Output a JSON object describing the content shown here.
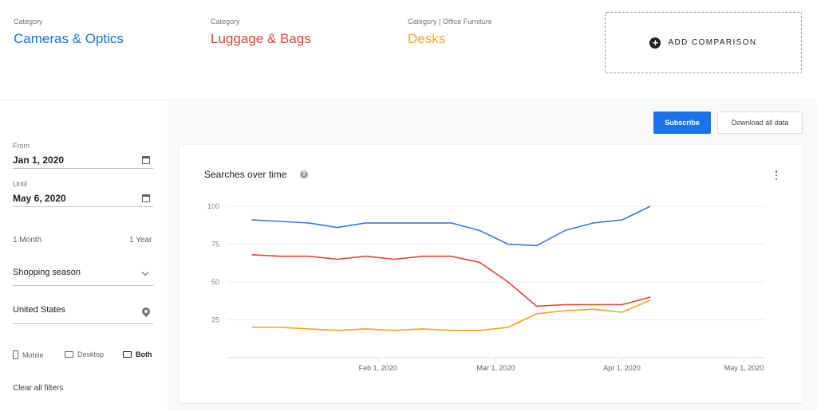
{
  "header": {
    "terms": [
      {
        "category": "Category",
        "name": "Cameras & Optics",
        "color": "#4285f4"
      },
      {
        "category": "Category",
        "name": "Luggage & Bags",
        "color": "#ea4335"
      },
      {
        "category": "Category | Office Furniture",
        "name": "Desks",
        "color": "#fbbc04"
      }
    ],
    "add_comparison": "ADD COMPARISON",
    "add_icon": "plus-circle-icon"
  },
  "filters": {
    "from_label": "From",
    "from_value": "Jan 1, 2020",
    "until_label": "Until",
    "until_value": "May 6, 2020",
    "range_short": "1 Month",
    "range_long": "1 Year",
    "season": "Shopping season",
    "region": "United States",
    "devices": [
      {
        "label": "Mobile",
        "icon": "phone-icon",
        "active": false
      },
      {
        "label": "Desktop",
        "icon": "laptop-icon",
        "active": false
      },
      {
        "label": "Both",
        "icon": "devices-icon",
        "active": true
      }
    ],
    "clear": "Clear all filters"
  },
  "actions": {
    "subscribe": "Subscribe",
    "download": "Download all data"
  },
  "card": {
    "title": "Searches over time",
    "help_icon": "help-icon",
    "menu_icon": "more-vert-icon"
  },
  "chart_data": {
    "type": "line",
    "title": "Searches over time",
    "xlabel": "",
    "ylabel": "",
    "x": [
      "2020-01-01",
      "2020-01-08",
      "2020-01-15",
      "2020-01-22",
      "2020-01-29",
      "2020-02-05",
      "2020-02-12",
      "2020-02-19",
      "2020-02-26",
      "2020-03-04",
      "2020-03-11",
      "2020-03-18",
      "2020-03-25",
      "2020-04-01",
      "2020-04-08",
      "2020-04-15"
    ],
    "x_ticks": [
      "Feb 1, 2020",
      "Mar 1, 2020",
      "Apr 1, 2020",
      "May 1, 2020"
    ],
    "x_tick_dates": [
      "2020-02-01",
      "2020-03-01",
      "2020-04-01",
      "2020-05-01"
    ],
    "xlim": [
      "2019-12-26",
      "2020-05-06"
    ],
    "ylim": [
      0,
      100
    ],
    "y_ticks": [
      25,
      50,
      75,
      100
    ],
    "grid": true,
    "legend": "none",
    "series": [
      {
        "name": "Cameras & Optics",
        "color": "#3b78e7",
        "values": [
          91,
          90,
          89,
          86,
          89,
          89,
          89,
          89,
          84,
          75,
          74,
          84,
          89,
          91,
          100,
          null
        ]
      },
      {
        "name": "Luggage & Bags",
        "color": "#ea4335",
        "values": [
          68,
          67,
          67,
          65,
          67,
          65,
          67,
          67,
          63,
          50,
          34,
          35,
          35,
          35,
          40,
          null
        ]
      },
      {
        "name": "Desks",
        "color": "#f4a41a",
        "values": [
          20,
          20,
          19,
          18,
          19,
          18,
          19,
          18,
          18,
          20,
          29,
          31,
          32,
          30,
          38,
          null
        ]
      }
    ]
  }
}
